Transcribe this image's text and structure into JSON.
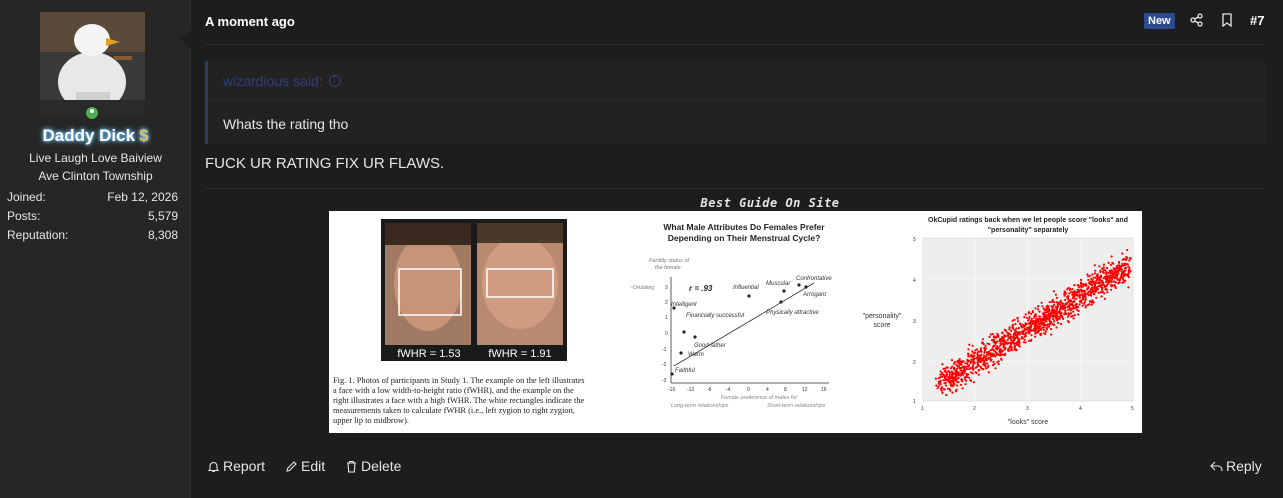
{
  "user": {
    "name": "Daddy Dick",
    "flair": "$",
    "title_line1": "Live Laugh Love Baiview",
    "title_line2": "Ave Clinton Township",
    "stats": [
      {
        "label": "Joined:",
        "value": "Feb 12, 2026"
      },
      {
        "label": "Posts:",
        "value": "5,579"
      },
      {
        "label": "Reputation:",
        "value": "8,308"
      }
    ]
  },
  "post": {
    "time": "A moment ago",
    "badge": "New",
    "number": "#7",
    "quote_author": "wizardious said:",
    "quote_text": "Whats the rating tho",
    "body": "FUCK UR RATING FIX UR FLAWS.",
    "image_caption": "Best Guide On Site"
  },
  "figure": {
    "panel1": {
      "label_left": "fWHR = 1.53",
      "label_right": "fWHR = 1.91",
      "caption_lines": [
        "Fig. 1.  Photos of participants in Study 1. The example on the left illustrates",
        "a face with a low width-to-height ratio (fWHR), and the example on the",
        "right illustrates a face with a high fWHR. The white rectangles indicate the",
        "measurements taken to calculate fWHR (i.e., left zygion to right zygion,",
        "upper lip to midbrow)."
      ]
    },
    "panel2": {
      "title1": "What Male Attributes Do Females Prefer",
      "title2": "Depending on Their Menstrual Cycle?",
      "y_label1": "Fertility status of",
      "y_label2": "the female",
      "ovulating": "~Ovulating",
      "r_value": "r = .93",
      "x_label1": "Female preference of males for",
      "x_label2_left": "Long-term relationships",
      "x_label2_right": "Short-term relationships",
      "points": [
        "Confrontative",
        "Muscular",
        "Influential",
        "Arrogant",
        "Physically attractive",
        "Intelligent",
        "Financially successful",
        "Good father",
        "Warm",
        "Faithful"
      ]
    },
    "panel3": {
      "title1": "OkCupid ratings back when we let people score \"looks\" and",
      "title2": "\"personality\" separately",
      "y_label1": "\"personality\"",
      "y_label2": "score",
      "x_label": "\"looks\" score"
    }
  },
  "actions": {
    "report": "Report",
    "edit": "Edit",
    "delete": "Delete",
    "reply": "Reply"
  },
  "colors": {
    "accent_badge": "#2b4a8f",
    "online": "#4caf50",
    "scatter": "#ff0000"
  }
}
